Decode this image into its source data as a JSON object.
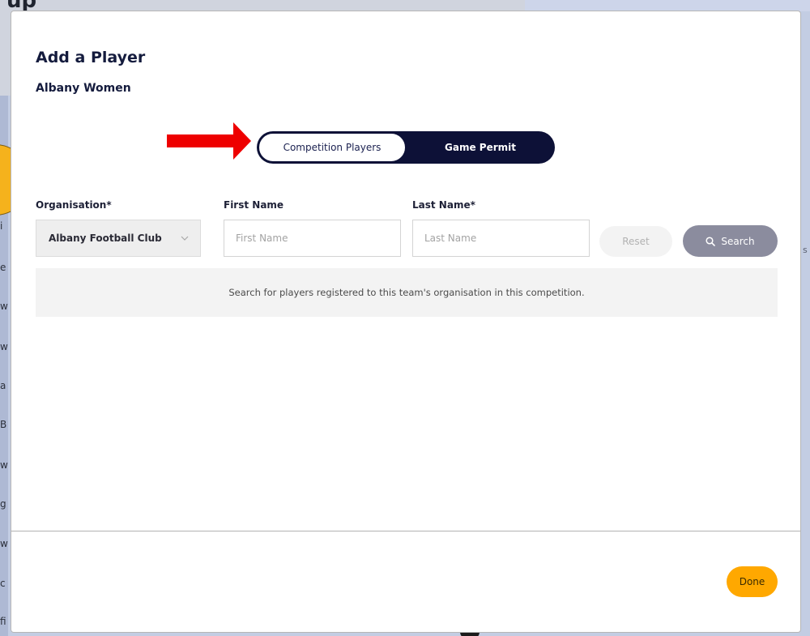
{
  "background": {
    "title_fragment": "up",
    "side_chars": [
      "i",
      "e",
      "w",
      "w",
      "a",
      "B",
      "w",
      "g",
      "w",
      "c",
      "fi"
    ],
    "right_char": "s"
  },
  "modal": {
    "title": "Add a Player",
    "subtitle": "Albany Women",
    "toggle": {
      "left_label": "Competition Players",
      "right_label": "Game Permit",
      "selected": "Competition Players"
    },
    "form": {
      "organisation_label": "Organisation*",
      "organisation_value": "Albany Football Club",
      "first_name_label": "First Name",
      "first_name_placeholder": "First Name",
      "first_name_value": "",
      "last_name_label": "Last Name*",
      "last_name_placeholder": "Last Name",
      "last_name_value": ""
    },
    "buttons": {
      "reset": "Reset",
      "search": "Search",
      "done": "Done"
    },
    "info_message": "Search for players registered to this team's organisation in this competition."
  },
  "colors": {
    "brand_navy": "#0d1137",
    "accent_orange": "#ffa800",
    "search_button": "#8b8c9e",
    "annotation_red": "#ee0000"
  },
  "icons": {
    "search": "search-icon",
    "chevron": "chevron-down-icon",
    "arrow": "red-arrow-annotation"
  }
}
